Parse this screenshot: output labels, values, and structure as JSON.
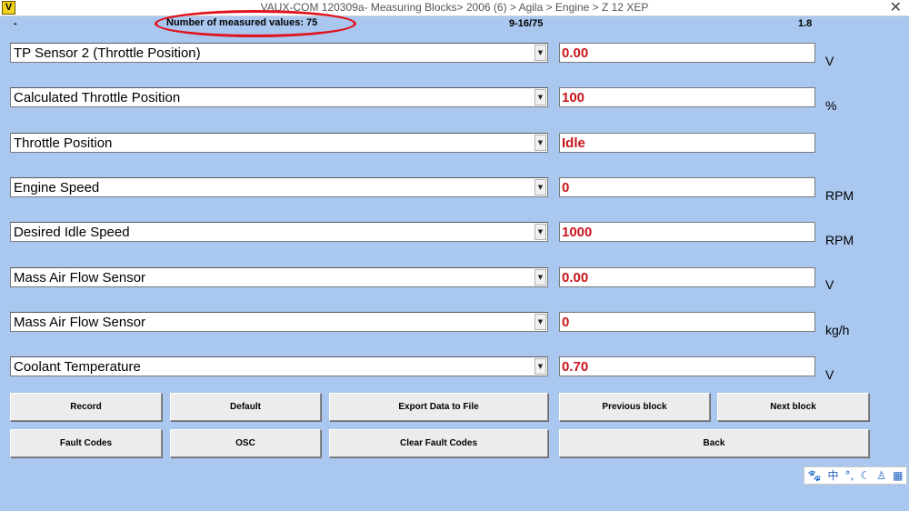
{
  "titlebar": {
    "app_icon": "V",
    "title": "VAUX-COM 120309a- Measuring Blocks> 2006 (6) > Agila > Engine > Z 12 XEP",
    "close": "✕"
  },
  "info": {
    "dash": "-",
    "measured_count": "Number of measured values: 75",
    "block_range": "9-16/75",
    "version": "1.8"
  },
  "rows": [
    {
      "label": "TP Sensor 2 (Throttle Position)",
      "value": "0.00",
      "unit": "V"
    },
    {
      "label": "Calculated Throttle Position",
      "value": "100",
      "unit": "%"
    },
    {
      "label": "Throttle Position",
      "value": "Idle",
      "unit": ""
    },
    {
      "label": "Engine Speed",
      "value": "0",
      "unit": "RPM"
    },
    {
      "label": "Desired Idle Speed",
      "value": "1000",
      "unit": "RPM"
    },
    {
      "label": "Mass Air Flow Sensor",
      "value": "0.00",
      "unit": "V"
    },
    {
      "label": "Mass Air Flow Sensor",
      "value": "0",
      "unit": "kg/h"
    },
    {
      "label": "Coolant Temperature",
      "value": "0.70",
      "unit": "V"
    }
  ],
  "dropdown_arrow": "▼",
  "buttons": {
    "record": "Record",
    "default": "Default",
    "export": "Export Data to File",
    "previous": "Previous block",
    "next": "Next block",
    "fault_codes": "Fault Codes",
    "osc": "OSC",
    "clear_fault_codes": "Clear Fault Codes",
    "back": "Back"
  },
  "ime_toolbar": {
    "paw": "🐾",
    "lang": "中",
    "punct": "°,",
    "moon": "☾",
    "user": "♙",
    "grid": "▦"
  },
  "colors": {
    "background": "#a9c7ef",
    "value_text": "#c8151b",
    "highlight": "#e0121b"
  }
}
